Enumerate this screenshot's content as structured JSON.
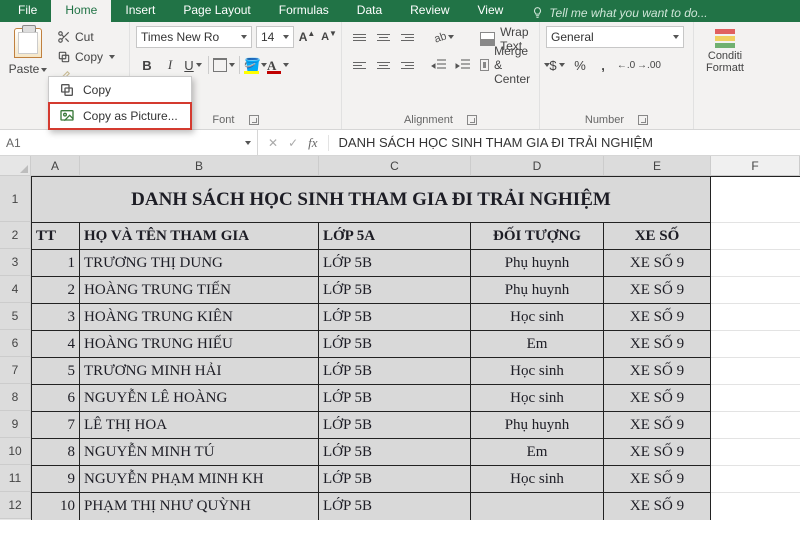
{
  "tabs": {
    "file": "File",
    "home": "Home",
    "insert": "Insert",
    "page_layout": "Page Layout",
    "formulas": "Formulas",
    "data": "Data",
    "review": "Review",
    "view": "View",
    "tell_me": "Tell me what you want to do..."
  },
  "ribbon": {
    "clipboard": {
      "paste": "Paste",
      "cut": "Cut",
      "copy": "Copy",
      "format_painter": "Format Painter"
    },
    "copy_menu": {
      "copy": "Copy",
      "copy_as_picture": "Copy as Picture...",
      "picture_accel": "P"
    },
    "font": {
      "group_label": "Font",
      "name": "Times New Ro",
      "size": "14",
      "bold": "B",
      "italic": "I",
      "underline": "U",
      "fill_letter": "A",
      "font_letter": "A",
      "grow": "A",
      "shrink": "A"
    },
    "alignment": {
      "group_label": "Alignment",
      "wrap_text": "Wrap Text",
      "merge_center": "Merge & Center"
    },
    "number": {
      "group_label": "Number",
      "format": "General",
      "currency": "$",
      "percent": "%",
      "comma": ",",
      "inc": ".0",
      "dec": ".00"
    },
    "cf": {
      "line1": "Conditi",
      "line2": "Formatt"
    }
  },
  "formula_bar": {
    "name_box": "A1",
    "cancel": "✕",
    "enter": "✓",
    "fx": "fx",
    "content": "DANH SÁCH HỌC SINH THAM GIA ĐI TRẢI NGHIỆM"
  },
  "columns": {
    "A": "A",
    "B": "B",
    "C": "C",
    "D": "D",
    "E": "E",
    "F": "F"
  },
  "row_labels": [
    "1",
    "2",
    "3",
    "4",
    "5",
    "6",
    "7",
    "8",
    "9",
    "10",
    "11",
    "12"
  ],
  "sheet": {
    "title": "DANH SÁCH HỌC SINH THAM GIA ĐI TRẢI NGHIỆM",
    "headers": {
      "tt": "TT",
      "name": "HỌ VÀ TÊN THAM GIA",
      "class": "LỚP 5A",
      "type": "ĐỐI TƯỢNG",
      "xe": "XE SỐ"
    },
    "rows": [
      {
        "tt": "1",
        "name": "TRƯƠNG THỊ DUNG",
        "class": "LỚP 5B",
        "type": "Phụ huynh",
        "xe": "XE  SỐ 9"
      },
      {
        "tt": "2",
        "name": "HOÀNG TRUNG TIẾN",
        "class": "LỚP 5B",
        "type": "Phụ huynh",
        "xe": "XE  SỐ 9"
      },
      {
        "tt": "3",
        "name": "HOÀNG TRUNG KIÊN",
        "class": "LỚP 5B",
        "type": "Học sinh",
        "xe": "XE  SỐ 9"
      },
      {
        "tt": "4",
        "name": "HOÀNG TRUNG HIẾU",
        "class": "LỚP 5B",
        "type": "Em",
        "xe": "XE  SỐ 9"
      },
      {
        "tt": "5",
        "name": "TRƯƠNG MINH HẢI",
        "class": "LỚP 5B",
        "type": "Học sinh",
        "xe": "XE  SỐ 9"
      },
      {
        "tt": "6",
        "name": "NGUYỄN LÊ HOÀNG",
        "class": "LỚP 5B",
        "type": "Học sinh",
        "xe": "XE  SỐ 9"
      },
      {
        "tt": "7",
        "name": "LÊ THỊ HOA",
        "class": "LỚP 5B",
        "type": "Phụ huynh",
        "xe": "XE  SỐ 9"
      },
      {
        "tt": "8",
        "name": "NGUYỄN MINH TÚ",
        "class": "LỚP 5B",
        "type": "Em",
        "xe": "XE  SỐ 9"
      },
      {
        "tt": "9",
        "name": "NGUYỄN PHẠM MINH KH",
        "class": "LỚP 5B",
        "type": "Học sinh",
        "xe": "XE  SỐ 9"
      },
      {
        "tt": "10",
        "name": "PHẠM THỊ NHƯ QUỲNH",
        "class": "LỚP 5B",
        "type": "",
        "xe": "XE  SỐ 9"
      }
    ]
  }
}
